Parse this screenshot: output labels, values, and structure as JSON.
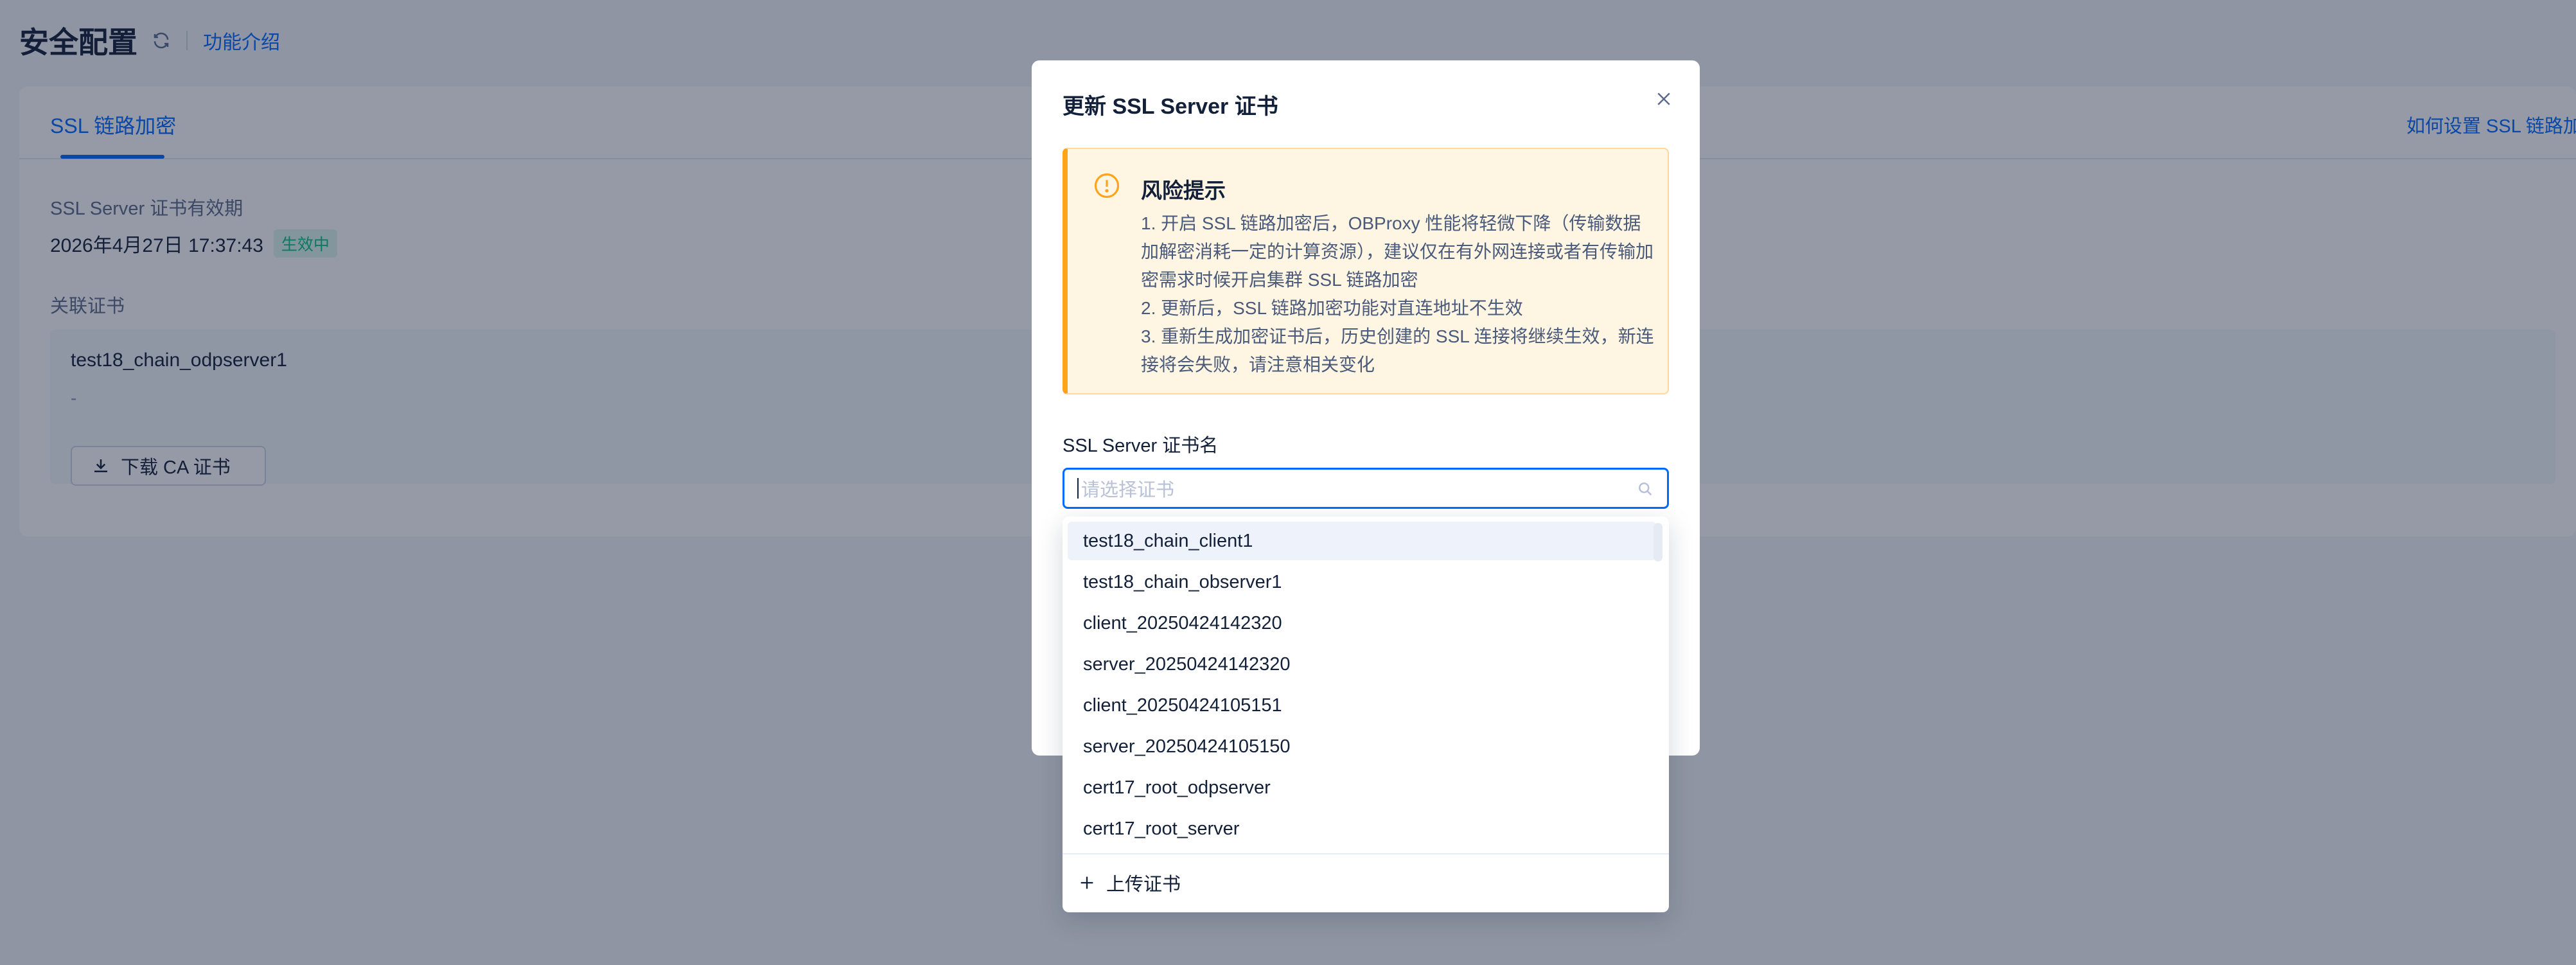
{
  "page": {
    "title": "安全配置",
    "intro_link": "功能介绍"
  },
  "tabs": [
    {
      "label": "SSL 链路加密",
      "active": true
    }
  ],
  "help_link": "如何设置 SSL 链路加",
  "certificate_info": {
    "validity_label": "SSL Server 证书有效期",
    "validity_value": "2026年4月27日 17:37:43",
    "status": "生效中",
    "linked_label": "关联证书",
    "cert_name": "test18_chain_odpserver1",
    "cert_desc": "-",
    "download_label": "下载 CA 证书"
  },
  "modal": {
    "title": "更新 SSL Server 证书",
    "alert": {
      "title": "风险提示",
      "lines": [
        "1. 开启 SSL 链路加密后，OBProxy 性能将轻微下降（传输数据加解密消耗一定的计算资源），建议仅在有外网连接或者有传输加密需求时候开启集群 SSL 链路加密",
        "2. 更新后，SSL 链路加密功能对直连地址不生效",
        "3. 重新生成加密证书后，历史创建的 SSL 连接将继续生效，新连接将会失败，请注意相关变化"
      ]
    },
    "select_label": "SSL Server 证书名",
    "select_placeholder": "请选择证书"
  },
  "dropdown": {
    "options": [
      "test18_chain_client1",
      "test18_chain_observer1",
      "client_20250424142320",
      "server_20250424142320",
      "client_20250424105151",
      "server_20250424105150",
      "cert17_root_odpserver",
      "cert17_root_server"
    ],
    "upload_label": "上传证书"
  },
  "colors": {
    "primary": "#006aff",
    "warning": "#ffa31a",
    "success": "#0ac185",
    "text": "#132039"
  }
}
